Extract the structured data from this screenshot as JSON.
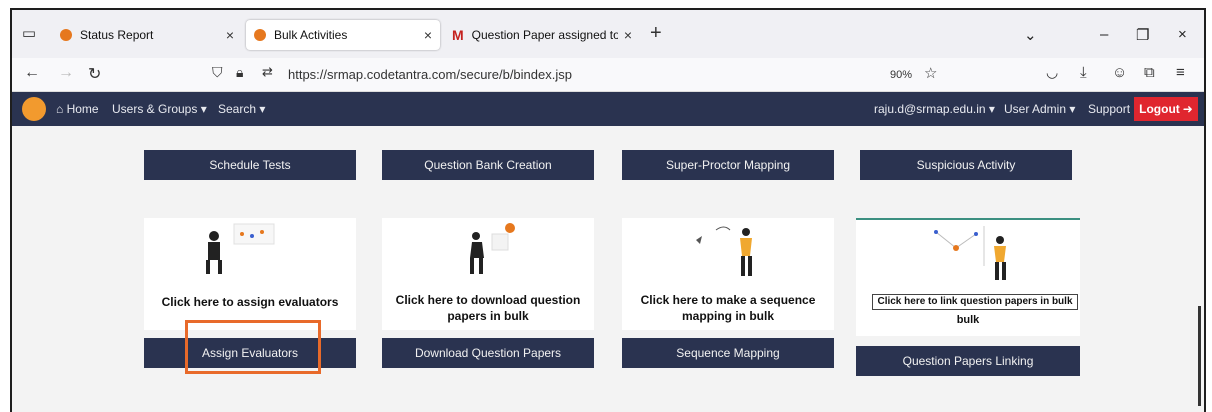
{
  "browser": {
    "tabs": [
      {
        "title": "Status Report",
        "favicon": "orange-dot",
        "active": false
      },
      {
        "title": "Bulk Activities",
        "favicon": "orange-dot",
        "active": true
      },
      {
        "title": "Question Paper assigned to yo",
        "favicon": "gmail-m",
        "active": false
      }
    ],
    "tab_close_glyph": "×",
    "new_tab_glyph": "+",
    "url": "https://srmap.codetantra.com/secure/b/bindex.jsp",
    "zoom": "90%",
    "window_controls": {
      "minimize": "–",
      "restore": "❐",
      "close": "×",
      "list": "⌄"
    }
  },
  "site_nav": {
    "home": "Home",
    "users_groups": "Users & Groups",
    "search": "Search",
    "user_email": "raju.d@srmap.edu.in",
    "user_admin": "User Admin",
    "support": "Support",
    "logout": "Logout"
  },
  "top_buttons": [
    "Schedule Tests",
    "Question Bank Creation",
    "Super-Proctor Mapping",
    "Suspicious Activity"
  ],
  "cards": [
    {
      "text": "Click here to assign evaluators",
      "button": "Assign Evaluators"
    },
    {
      "text": "Click here to download question papers in bulk",
      "button": "Download Question Papers"
    },
    {
      "text": "Click here to make a sequence mapping in bulk",
      "button": "Sequence Mapping"
    },
    {
      "text": "bulk",
      "button": "Question Papers Linking",
      "tooltip": "Click here to link question papers in bulk"
    }
  ],
  "colors": {
    "navbar": "#2a3350",
    "button_dark": "#2a3350",
    "logout_red": "#e0262f",
    "highlight": "#e86a2a",
    "accent_orange": "#f29a2e"
  }
}
